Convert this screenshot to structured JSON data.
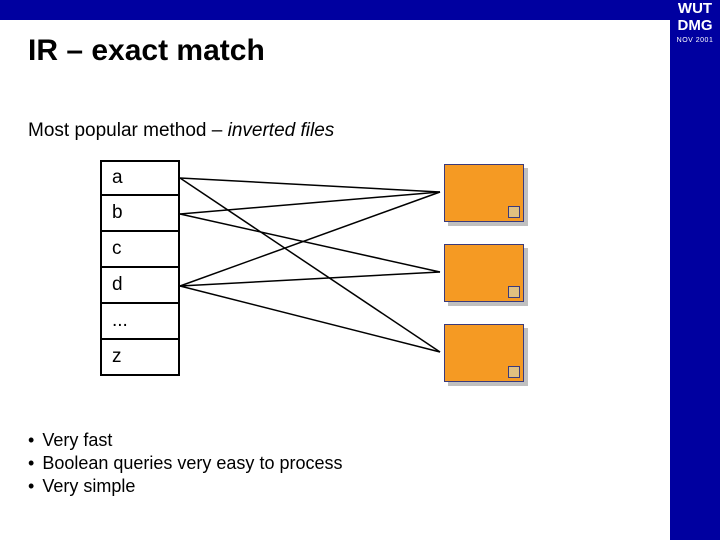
{
  "header": {
    "org_line1": "WUT",
    "org_line2": "DMG",
    "date": "NOV 2001"
  },
  "title": "IR – exact match",
  "subtitle_plain": "Most popular method – ",
  "subtitle_italic": "inverted files",
  "terms": [
    "a",
    "b",
    "c",
    "d",
    "...",
    "z"
  ],
  "bullets": [
    "Very fast",
    "Boolean queries very easy to process",
    "Very simple"
  ],
  "diagram": {
    "description": "Inverted file index: dictionary terms on left map to posting documents on right",
    "term_boxes": 6,
    "doc_boxes": 3,
    "connections": [
      {
        "from_term": 0,
        "to_doc": 0
      },
      {
        "from_term": 0,
        "to_doc": 2
      },
      {
        "from_term": 1,
        "to_doc": 0
      },
      {
        "from_term": 1,
        "to_doc": 1
      },
      {
        "from_term": 3,
        "to_doc": 0
      },
      {
        "from_term": 3,
        "to_doc": 1
      },
      {
        "from_term": 3,
        "to_doc": 2
      }
    ]
  }
}
